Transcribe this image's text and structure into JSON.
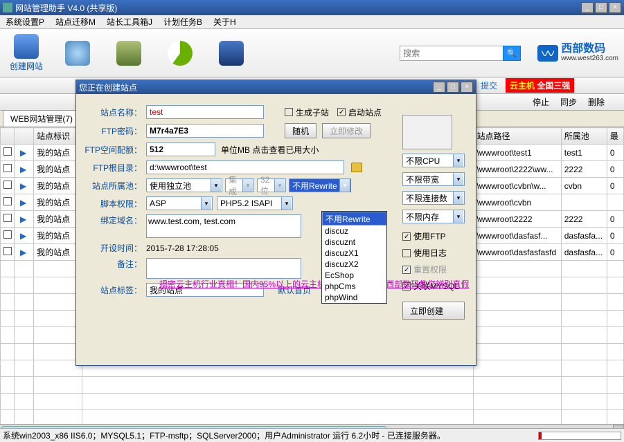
{
  "window": {
    "title": "网站管理助手  V4.0  (共享版)"
  },
  "menu": [
    "系统设置P",
    "站点迁移M",
    "站长工具箱J",
    "计划任务B",
    "关于H"
  ],
  "toolbar": [
    {
      "label": "创建网站",
      "color": "#2a6fd6"
    },
    {
      "label": "",
      "color": "#5aa8e0"
    },
    {
      "label": "",
      "color": "#5a8a40"
    },
    {
      "label": "",
      "color": "#6ab000"
    },
    {
      "label": "",
      "color": "#2860b0"
    }
  ],
  "search": {
    "placeholder": "搜索"
  },
  "logo": {
    "brand": "西部数码",
    "url": "www.west263.com"
  },
  "subbar": {
    "submit": "提交",
    "banner1": "云主机",
    "banner2": "全国三强",
    "btns": [
      "停止",
      "同步",
      "删除"
    ]
  },
  "tab": "WEB网站管理(7)",
  "cols": {
    "c1": "",
    "c2": "站点标识",
    "bk": "站点路径",
    "pool": "所属池",
    "last": "最"
  },
  "rows": [
    {
      "tag": "我的站点",
      "path": "\\wwwroot\\test1",
      "pool": "test1",
      "last": "0"
    },
    {
      "tag": "我的站点",
      "path": "\\wwwroot\\2222\\ww...",
      "pool": "2222",
      "last": "0"
    },
    {
      "tag": "我的站点",
      "path": "\\wwwroot\\cvbn\\w...",
      "pool": "cvbn",
      "last": "0"
    },
    {
      "tag": "我的站点",
      "path": "\\wwwroot\\cvbn",
      "pool": "",
      "last": ""
    },
    {
      "tag": "我的站点",
      "path": "\\wwwroot\\2222",
      "pool": "2222",
      "last": "0"
    },
    {
      "tag": "我的站点",
      "path": "\\wwwroot\\dasfasf...",
      "pool": "dasfasfa...",
      "last": "0"
    },
    {
      "tag": "我的站点",
      "path": "\\wwwroot\\dasfasfasfd",
      "pool": "dasfasfa...",
      "last": "0"
    }
  ],
  "dlg": {
    "title": "您正在创建站点",
    "labels": {
      "name": "站点名称：",
      "pwd": "FTP密码：",
      "quota": "FTP空间配额：",
      "root": "FTP根目录：",
      "pool": "站点所属池：",
      "script": "脚本权限：",
      "domain": "绑定域名：",
      "time": "开设时间：",
      "note": "备注：",
      "tag": "站点标签："
    },
    "vals": {
      "name": "test",
      "pwd": "M7r4a7E3",
      "quota": "512",
      "quota_unit": "单位MB 点击查看已用大小",
      "root": "d:\\wwwroot\\test",
      "pool": "使用独立池",
      "jc": "集成",
      "bit": "32位",
      "rw": "不用Rewrite",
      "script": "ASP",
      "php": "PHP5.2 ISAPI",
      "domain": "www.test.com, test.com",
      "time": "2015-7-28 17:28:05",
      "tag": "我的站点",
      "home": "默认首页"
    },
    "btns": {
      "rand": "随机",
      "mod": "立即修改",
      "create": "立即创建"
    },
    "chks": {
      "child": "生成子站",
      "start": "启动站点",
      "ftp": "使用FTP",
      "log": "使用日志",
      "perm": "重置权限",
      "mysql": "关联MYSQL"
    },
    "limits": [
      "不限CPU",
      "不限带宽",
      "不限连接数",
      "不限内存"
    ],
    "promo": "揭密云主机行业真相！国内95%以上的云主机是假云、是VPS 西部数码教您辨别真假"
  },
  "dropdown": [
    "不用Rewrite",
    "discuz",
    "discuznt",
    "discuzX1",
    "discuzX2",
    "EcShop",
    "phpCms",
    "phpWind"
  ],
  "status": "系统win2003_x86 IIS6.0；MYSQL5.1；FTP-msftp；SQLServer2000；用户Administrator 运行 6.2小时 - 已连接服务器。"
}
